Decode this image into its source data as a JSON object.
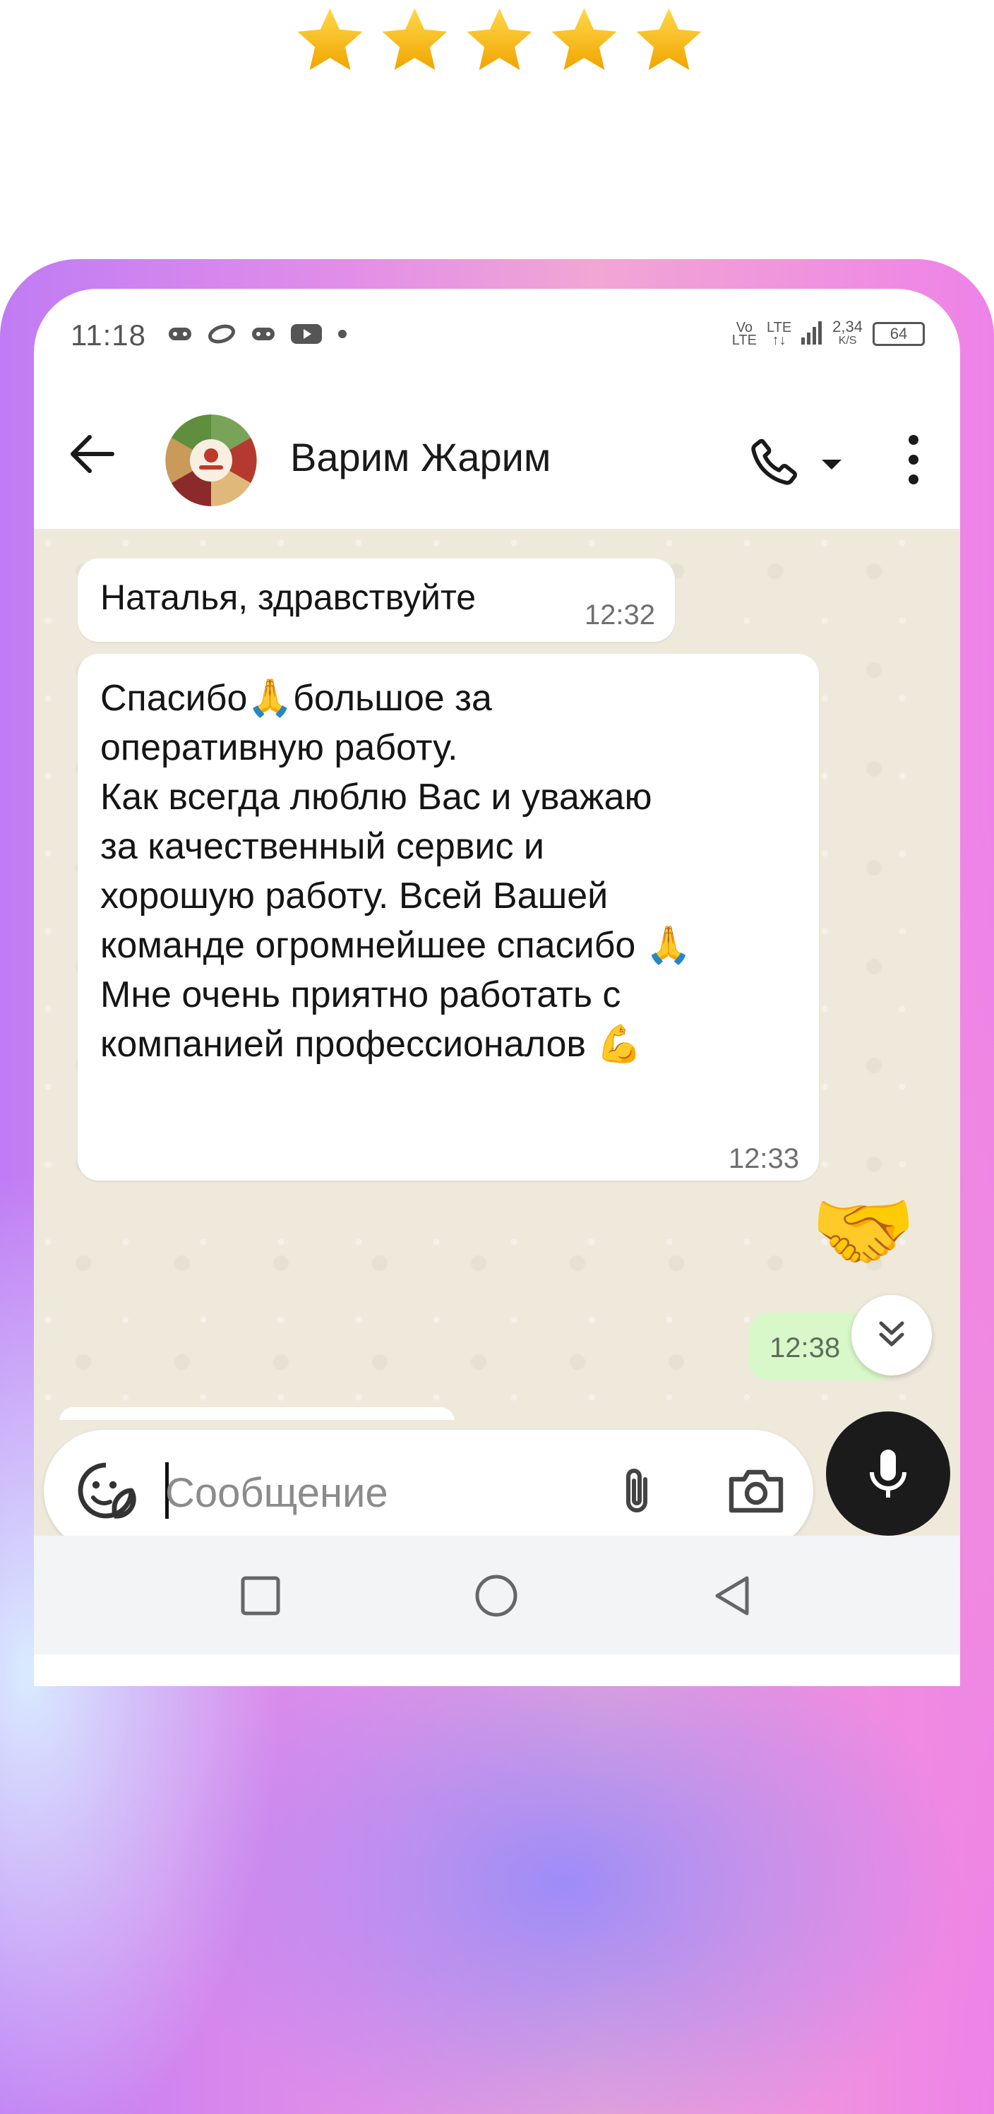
{
  "rating": {
    "stars": 5,
    "max": 5,
    "color": "#f5b400"
  },
  "status_bar": {
    "time": "11:18",
    "network_top": "Vo",
    "network_bottom": "LTE",
    "network2_top": "LTE",
    "network2_bottom": "↑↓",
    "speed_top": "2,34",
    "speed_bottom": "K/S",
    "battery": "64",
    "icons": [
      "gamepad-icon",
      "ring-icon",
      "gamepad-icon",
      "youtube-icon",
      "dot-icon"
    ]
  },
  "header": {
    "title": "Варим Жарим",
    "avatar": "food-avatar",
    "icons": [
      "back-arrow-icon",
      "phone-icon",
      "caret-down-icon",
      "more-vert-icon"
    ]
  },
  "messages": [
    {
      "direction": "in",
      "text": "Наталья, здравствуйте",
      "time": "12:32"
    },
    {
      "direction": "in",
      "lines": [
        {
          "before": "Спасибо",
          "emoji": "🙏",
          "after": "большое за"
        },
        {
          "text": "оперативную работу."
        },
        {
          "text": "Как всегда люблю Вас и уважаю"
        },
        {
          "text": "за качественный сервис и"
        },
        {
          "text": "хорошую работу. Всей Вашей"
        },
        {
          "before": "команде огромнейшее спасибо ",
          "emoji": "🙏",
          "after": ""
        },
        {
          "text": "Мне очень приятно работать с"
        },
        {
          "before": "компанией профессионалов ",
          "emoji": "💪",
          "after": ""
        }
      ],
      "time": "12:33"
    },
    {
      "direction": "out",
      "sticker": "🤝",
      "time": "12:38"
    }
  ],
  "composer": {
    "placeholder": "Сообщение",
    "icons": [
      "sticker-icon",
      "attach-icon",
      "camera-icon",
      "mic-icon"
    ]
  },
  "navigation": {
    "icons": [
      "recents-icon",
      "home-icon",
      "back-icon"
    ]
  },
  "colors": {
    "chat_background": "#efe9dc",
    "incoming_bubble": "#ffffff",
    "outgoing_bubble": "#d8f8c9",
    "mic_button": "#1b1b1b"
  }
}
